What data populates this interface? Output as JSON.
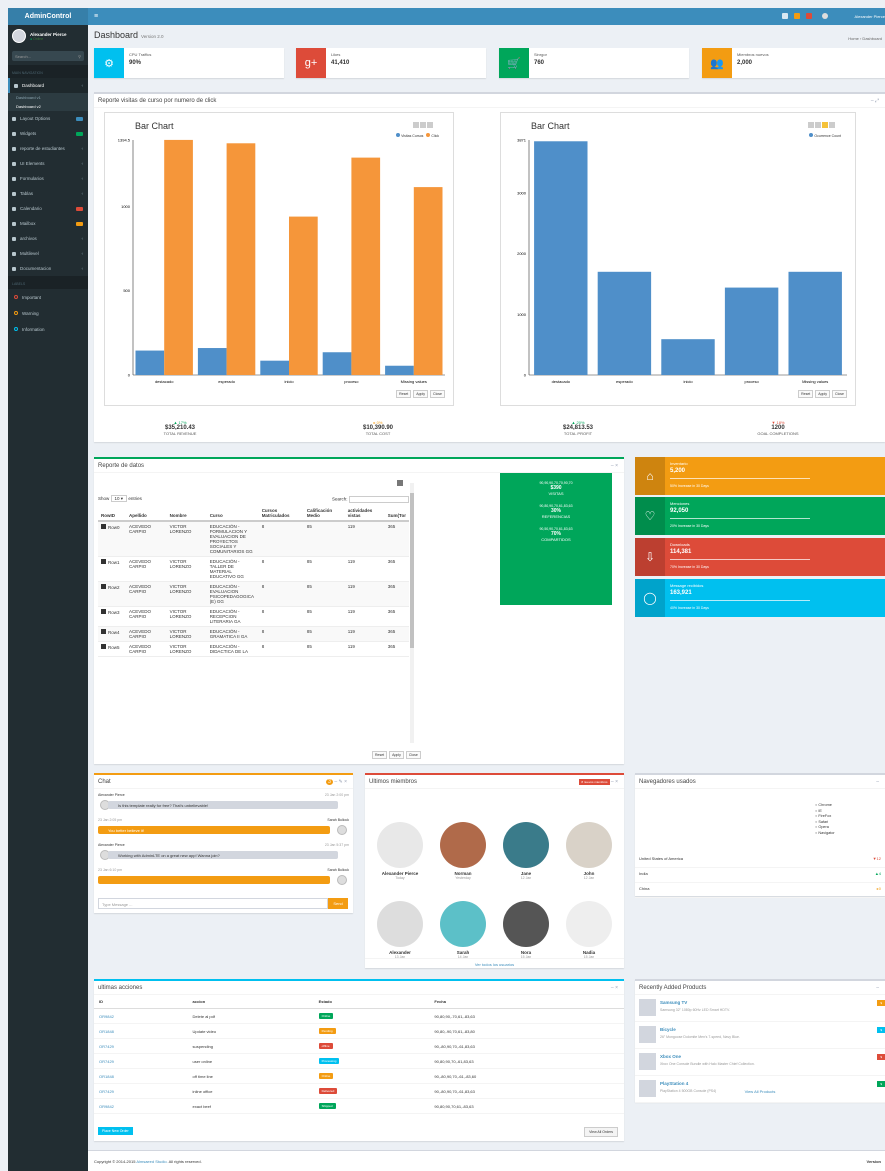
{
  "brand": "AdminControl",
  "user": {
    "name": "Alexander Pierce",
    "status": "Online"
  },
  "search_placeholder": "Search...",
  "nav_header": "MAIN NAVIGATION",
  "nav": [
    {
      "label": "Dashboard",
      "active": true
    },
    {
      "label": "Layout Options",
      "badge": "#3c8dbc"
    },
    {
      "label": "Widgets",
      "badge": "#00a65a",
      "badge_text": "new"
    },
    {
      "label": "reporte de estudiantes"
    },
    {
      "label": "UI Elements"
    },
    {
      "label": "Formularios"
    },
    {
      "label": "Tablas"
    },
    {
      "label": "Calendario",
      "badge": "#dd4b39"
    },
    {
      "label": "Mailbox",
      "badge": "#f39c12"
    },
    {
      "label": "archivos"
    },
    {
      "label": "Multilevel"
    },
    {
      "label": "Documentacion"
    }
  ],
  "subnav": [
    "Dashboard v1",
    "Dashboard v2"
  ],
  "labels_header": "LABELS",
  "labels": [
    {
      "label": "Important",
      "color": "#dd4b39"
    },
    {
      "label": "Warning",
      "color": "#f39c12"
    },
    {
      "label": "Information",
      "color": "#00c0ef"
    }
  ],
  "top_user": "Alexander Pierce",
  "page": {
    "title": "Dashboard",
    "version": "Version 2.0",
    "breadcrumb": "Home › Dashboard"
  },
  "infoboxes": [
    {
      "label": "CPU Traffics",
      "value": "90%",
      "color": "#00c0ef",
      "icon": "gear-icon"
    },
    {
      "label": "Likes",
      "value": "41,410",
      "color": "#dd4b39",
      "icon": "google-plus-icon"
    },
    {
      "label": "Sinrgor",
      "value": "760",
      "color": "#00a65a",
      "icon": "cart-icon"
    },
    {
      "label": "Miembros nuevos",
      "value": "2,000",
      "color": "#f39c12",
      "icon": "users-icon"
    }
  ],
  "report_title": "Reporte visitas de curso por numero de click",
  "charts": {
    "title": "Bar Chart",
    "buttons": [
      "Reset",
      "Apply",
      "Close"
    ]
  },
  "chart_data": [
    {
      "type": "bar",
      "title": "Bar Chart",
      "categories": [
        "destacado",
        "esperado",
        "inicio",
        "proceso",
        "Missing values"
      ],
      "series": [
        {
          "name": "Visitas Cursos",
          "color": "#4f8fc9",
          "values": [
            145,
            160,
            85,
            135,
            55
          ]
        },
        {
          "name": "Click",
          "color": "#f5963a",
          "values": [
            1395,
            1375,
            940,
            1290,
            1115
          ]
        }
      ],
      "yticks": [
        0,
        500,
        1000,
        1394.5
      ],
      "ylim": [
        0,
        1394.5
      ]
    },
    {
      "type": "bar",
      "title": "Bar Chart",
      "categories": [
        "destacado",
        "esperado",
        "inicio",
        "proceso",
        "Missing values"
      ],
      "series": [
        {
          "name": "Ocurrence Count",
          "color": "#4f8fc9",
          "values": [
            3850,
            1700,
            590,
            1440,
            1700
          ]
        }
      ],
      "yticks": [
        0,
        1000,
        2000,
        3000,
        3871
      ],
      "ylim": [
        0,
        3871
      ]
    }
  ],
  "kpis": [
    {
      "pct": "▲ 17%",
      "value": "$35,210.43",
      "label": "TOTAL REVENUE",
      "color": "#00a65a"
    },
    {
      "pct": "▸ 0%",
      "value": "$10,390.90",
      "label": "TOTAL COST",
      "color": "#f39c12"
    },
    {
      "pct": "▲ 20%",
      "value": "$24,813.53",
      "label": "TOTAL PROFIT",
      "color": "#00a65a"
    },
    {
      "pct": "▼ 18%",
      "value": "1200",
      "label": "GOAL COMPLETIONS",
      "color": "#dd4b39"
    }
  ],
  "datos": {
    "title": "Reporte de datos",
    "show": "Show",
    "entries": "entries",
    "search": "Search:",
    "columns": [
      "RowID",
      "Apellido",
      "Nombre",
      "Curso",
      "Cursos Matriculados",
      "Calificación Medio",
      "actividades vistas",
      "Sum(Tor"
    ],
    "rows": [
      [
        "Row0",
        "ACEVEDO CARPIO",
        "VICTOR LORENZO",
        "EDUCACIÓN - FORMULACION Y EVALUACION DE PROYECTOS SOCIALES Y COMUNITARIOS GG",
        "8",
        "85",
        "119",
        "365"
      ],
      [
        "Row1",
        "ACEVEDO CARPIO",
        "VICTOR LORENZO",
        "EDUCACIÓN - TALLER DE MATERIAL EDUCATIVO GG",
        "8",
        "85",
        "119",
        "365"
      ],
      [
        "Row2",
        "ACEVEDO CARPIO",
        "VICTOR LORENZO",
        "EDUCACIÓN - EVALUACION PSICOPEDAGOGICA (E) GG",
        "8",
        "85",
        "119",
        "365"
      ],
      [
        "Row3",
        "ACEVEDO CARPIO",
        "VICTOR LORENZO",
        "EDUCACIÓN - RECEPCION LITERARIA GA",
        "8",
        "85",
        "119",
        "365"
      ],
      [
        "Row4",
        "ACEVEDO CARPIO",
        "VICTOR LORENZO",
        "EDUCACIÓN - GRAMATICA II GA",
        "8",
        "85",
        "119",
        "365"
      ],
      [
        "Row5",
        "ACEVEDO CARPIO",
        "VICTOR LORENZO",
        "EDUCACIÓN - DIDACTICA DE LA",
        "8",
        "85",
        "119",
        "365"
      ]
    ]
  },
  "green_stats": [
    {
      "a": "90,90,90,70,70,90,70",
      "b": "$390",
      "c": "VISITAS"
    },
    {
      "a": "90,80,90,70,61,83,63",
      "b": "30%",
      "c": "REFERENCIAS"
    },
    {
      "a": "90,50,90,70,61,83,63",
      "b": "70%",
      "c": "COMPARTIDOS"
    }
  ],
  "side_boxes": [
    {
      "title": "Inventario",
      "value": "5,200",
      "desc": "50% Increase in 30 Days",
      "color": "#f39c12",
      "icon": "tag-icon"
    },
    {
      "title": "Menciones",
      "value": "92,050",
      "desc": "20% Increase in 30 Days",
      "color": "#00a65a",
      "icon": "heart-icon"
    },
    {
      "title": "Downloads",
      "value": "114,381",
      "desc": "70% Increase in 30 Days",
      "color": "#dd4b39",
      "icon": "cloud-download-icon"
    },
    {
      "title": "Message recibidos",
      "value": "163,921",
      "desc": "40% Increase in 30 Days",
      "color": "#00c0ef",
      "icon": "comment-icon"
    }
  ],
  "chat": {
    "title": "Chat",
    "messages": [
      {
        "name": "Alexander Pierce",
        "time": "23 Jan 2:00 pm",
        "text": "Is this template really for free? That's unbelievable!",
        "side": "left"
      },
      {
        "name": "Sarah Bullock",
        "time": "23 Jan 2:05 pm",
        "text": "You better believe it!",
        "side": "right"
      },
      {
        "name": "Alexander Pierce",
        "time": "23 Jan 5:37 pm",
        "text": "Working with AdminLTE on a great new app! Wanna join?",
        "side": "left"
      },
      {
        "name": "Sarah Bullock",
        "time": "23 Jan 6:10 pm",
        "text": "",
        "side": "right"
      }
    ],
    "placeholder": "Type Message ...",
    "send": "Send"
  },
  "members": {
    "title": "Ultimos miembros",
    "badge": "8 nuevos miembros",
    "view_all": "Ver todos los usuarios",
    "list": [
      {
        "name": "Alexander Pierce",
        "date": "Today"
      },
      {
        "name": "Norman",
        "date": "Yesterday"
      },
      {
        "name": "Jane",
        "date": "12 Jan"
      },
      {
        "name": "John",
        "date": "12 Jan"
      },
      {
        "name": "Alexander",
        "date": "13 Jan"
      },
      {
        "name": "Sarah",
        "date": "14 Jan"
      },
      {
        "name": "Nora",
        "date": "15 Jan"
      },
      {
        "name": "Nadia",
        "date": "15 Jan"
      }
    ]
  },
  "browsers": {
    "title": "Navegadores usados",
    "legend": [
      "Chrome",
      "IE",
      "FireFox",
      "Safari",
      "Opera",
      "Navigator"
    ],
    "rows": [
      {
        "label": "United States of America",
        "val": "▼12"
      },
      {
        "label": "India",
        "val": "▲4"
      },
      {
        "label": "China",
        "val": "▸0"
      }
    ]
  },
  "orders": {
    "title": "ultimas acciones",
    "columns": [
      "ID",
      "accion",
      "Estado",
      "Fecha"
    ],
    "rows": [
      {
        "id": "OR9842",
        "accion": "Delete al pdf",
        "estado": "Online",
        "color": "#00a65a",
        "fecha": "90,80,90,-70,61,-83,63"
      },
      {
        "id": "OR1848",
        "accion": "Update video",
        "estado": "Pending",
        "color": "#f39c12",
        "fecha": "90,80,-90,70,61,-83,80"
      },
      {
        "id": "OR7429",
        "accion": "suspending",
        "estado": "offline",
        "color": "#dd4b39",
        "fecha": "90,-80,90,70,-61,83,63"
      },
      {
        "id": "OR7429",
        "accion": "user online",
        "estado": "Processing",
        "color": "#00c0ef",
        "fecha": "90,80,90,70,-61,83,63"
      },
      {
        "id": "OR1848",
        "accion": "off time line",
        "estado": "Online",
        "color": "#f39c12",
        "fecha": "90,-80,90,70,-61,-83,60"
      },
      {
        "id": "OR7429",
        "accion": "inline office",
        "estado": "Delivered",
        "color": "#dd4b39",
        "fecha": "90,-80,90,70,-61,83,63"
      },
      {
        "id": "OR9842",
        "accion": "exact beef",
        "estado": "Shipped",
        "color": "#00a65a",
        "fecha": "90,80,90,70,61,-83,63"
      }
    ],
    "place": "Place New Order",
    "view": "View All Orders"
  },
  "products": {
    "title": "Recently Added Products",
    "view": "View All Products",
    "list": [
      {
        "name": "Samsung TV",
        "desc": "Samsung 32\" 1080p 60Hz LED Smart HDTV.",
        "color": "#f39c12"
      },
      {
        "name": "Bicycle",
        "desc": "26\" Mongoose Dolomite Men's 7-speed, Navy Blue.",
        "color": "#00c0ef"
      },
      {
        "name": "Xbox One",
        "desc": "Xbox One Console Bundle with Halo Master Chief Collection.",
        "color": "#dd4b39"
      },
      {
        "name": "PlayStation 4",
        "desc": "PlayStation 4 500GB Console (PS4)",
        "color": "#00a65a"
      }
    ]
  },
  "footer": {
    "copy": "Copyright © 2014-2015",
    "studio": "Almsaeed Studio.",
    "rights": "All rights reserved.",
    "version": "Version"
  }
}
